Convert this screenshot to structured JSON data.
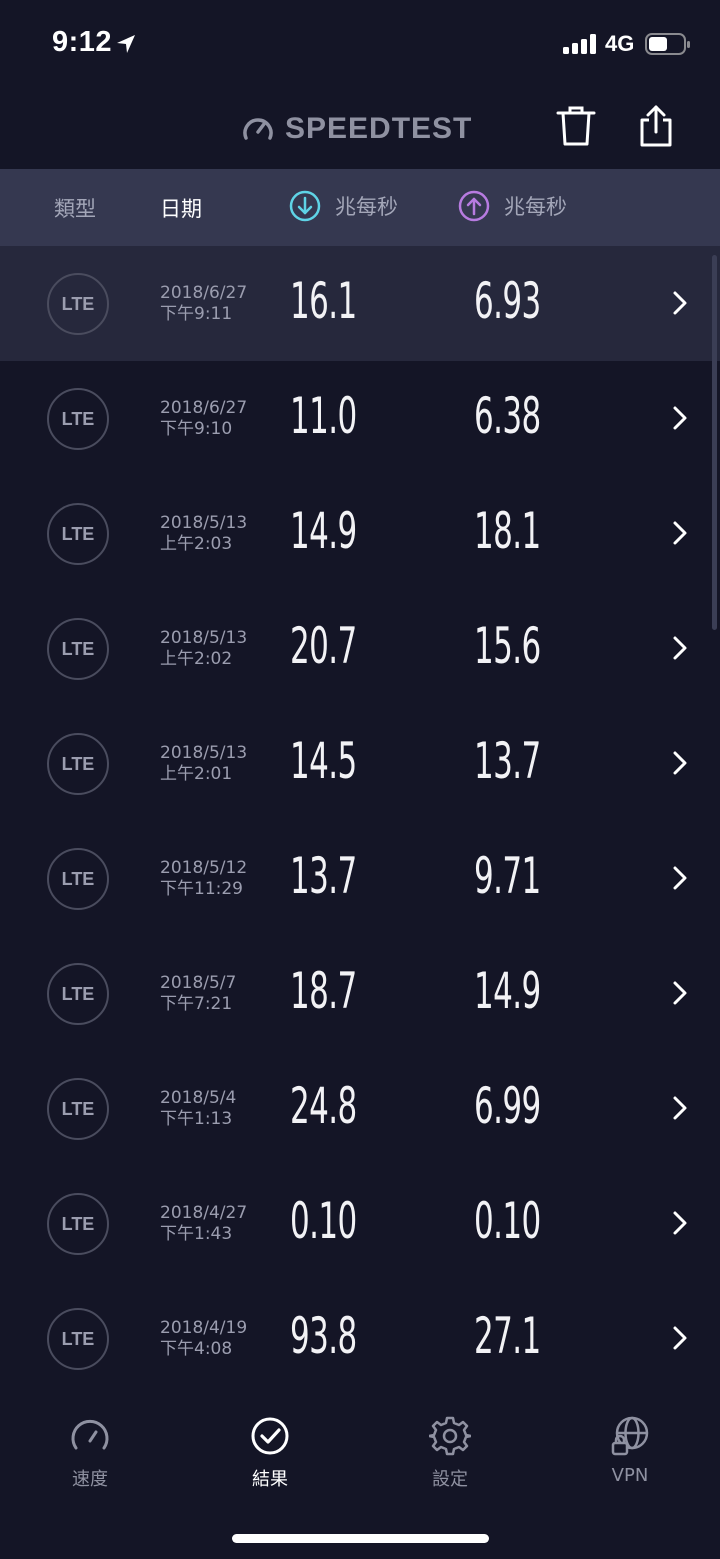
{
  "status_bar": {
    "time": "9:12",
    "network": "4G"
  },
  "header": {
    "app_name": "SPEEDTEST"
  },
  "columns": {
    "type": "類型",
    "date": "日期",
    "download_unit": "兆每秒",
    "upload_unit": "兆每秒"
  },
  "colors": {
    "background": "#141526",
    "header_bar": "#353850",
    "download_accent": "#5fd3e6",
    "upload_accent": "#b77be0",
    "selected_row": "#26283c"
  },
  "results": [
    {
      "type": "LTE",
      "date": "2018/6/27",
      "time": "下午9:11",
      "download": "16.1",
      "upload": "6.93",
      "selected": true
    },
    {
      "type": "LTE",
      "date": "2018/6/27",
      "time": "下午9:10",
      "download": "11.0",
      "upload": "6.38"
    },
    {
      "type": "LTE",
      "date": "2018/5/13",
      "time": "上午2:03",
      "download": "14.9",
      "upload": "18.1"
    },
    {
      "type": "LTE",
      "date": "2018/5/13",
      "time": "上午2:02",
      "download": "20.7",
      "upload": "15.6"
    },
    {
      "type": "LTE",
      "date": "2018/5/13",
      "time": "上午2:01",
      "download": "14.5",
      "upload": "13.7"
    },
    {
      "type": "LTE",
      "date": "2018/5/12",
      "time": "下午11:29",
      "download": "13.7",
      "upload": "9.71"
    },
    {
      "type": "LTE",
      "date": "2018/5/7",
      "time": "下午7:21",
      "download": "18.7",
      "upload": "14.9"
    },
    {
      "type": "LTE",
      "date": "2018/5/4",
      "time": "下午1:13",
      "download": "24.8",
      "upload": "6.99"
    },
    {
      "type": "LTE",
      "date": "2018/4/27",
      "time": "下午1:43",
      "download": "0.10",
      "upload": "0.10"
    },
    {
      "type": "LTE",
      "date": "2018/4/19",
      "time": "下午4:08",
      "download": "93.8",
      "upload": "27.1"
    }
  ],
  "tabs": [
    {
      "label": "速度",
      "icon": "speedometer-icon",
      "active": false
    },
    {
      "label": "結果",
      "icon": "check-circle-icon",
      "active": true
    },
    {
      "label": "設定",
      "icon": "gear-icon",
      "active": false
    },
    {
      "label": "VPN",
      "icon": "globe-lock-icon",
      "active": false
    }
  ]
}
